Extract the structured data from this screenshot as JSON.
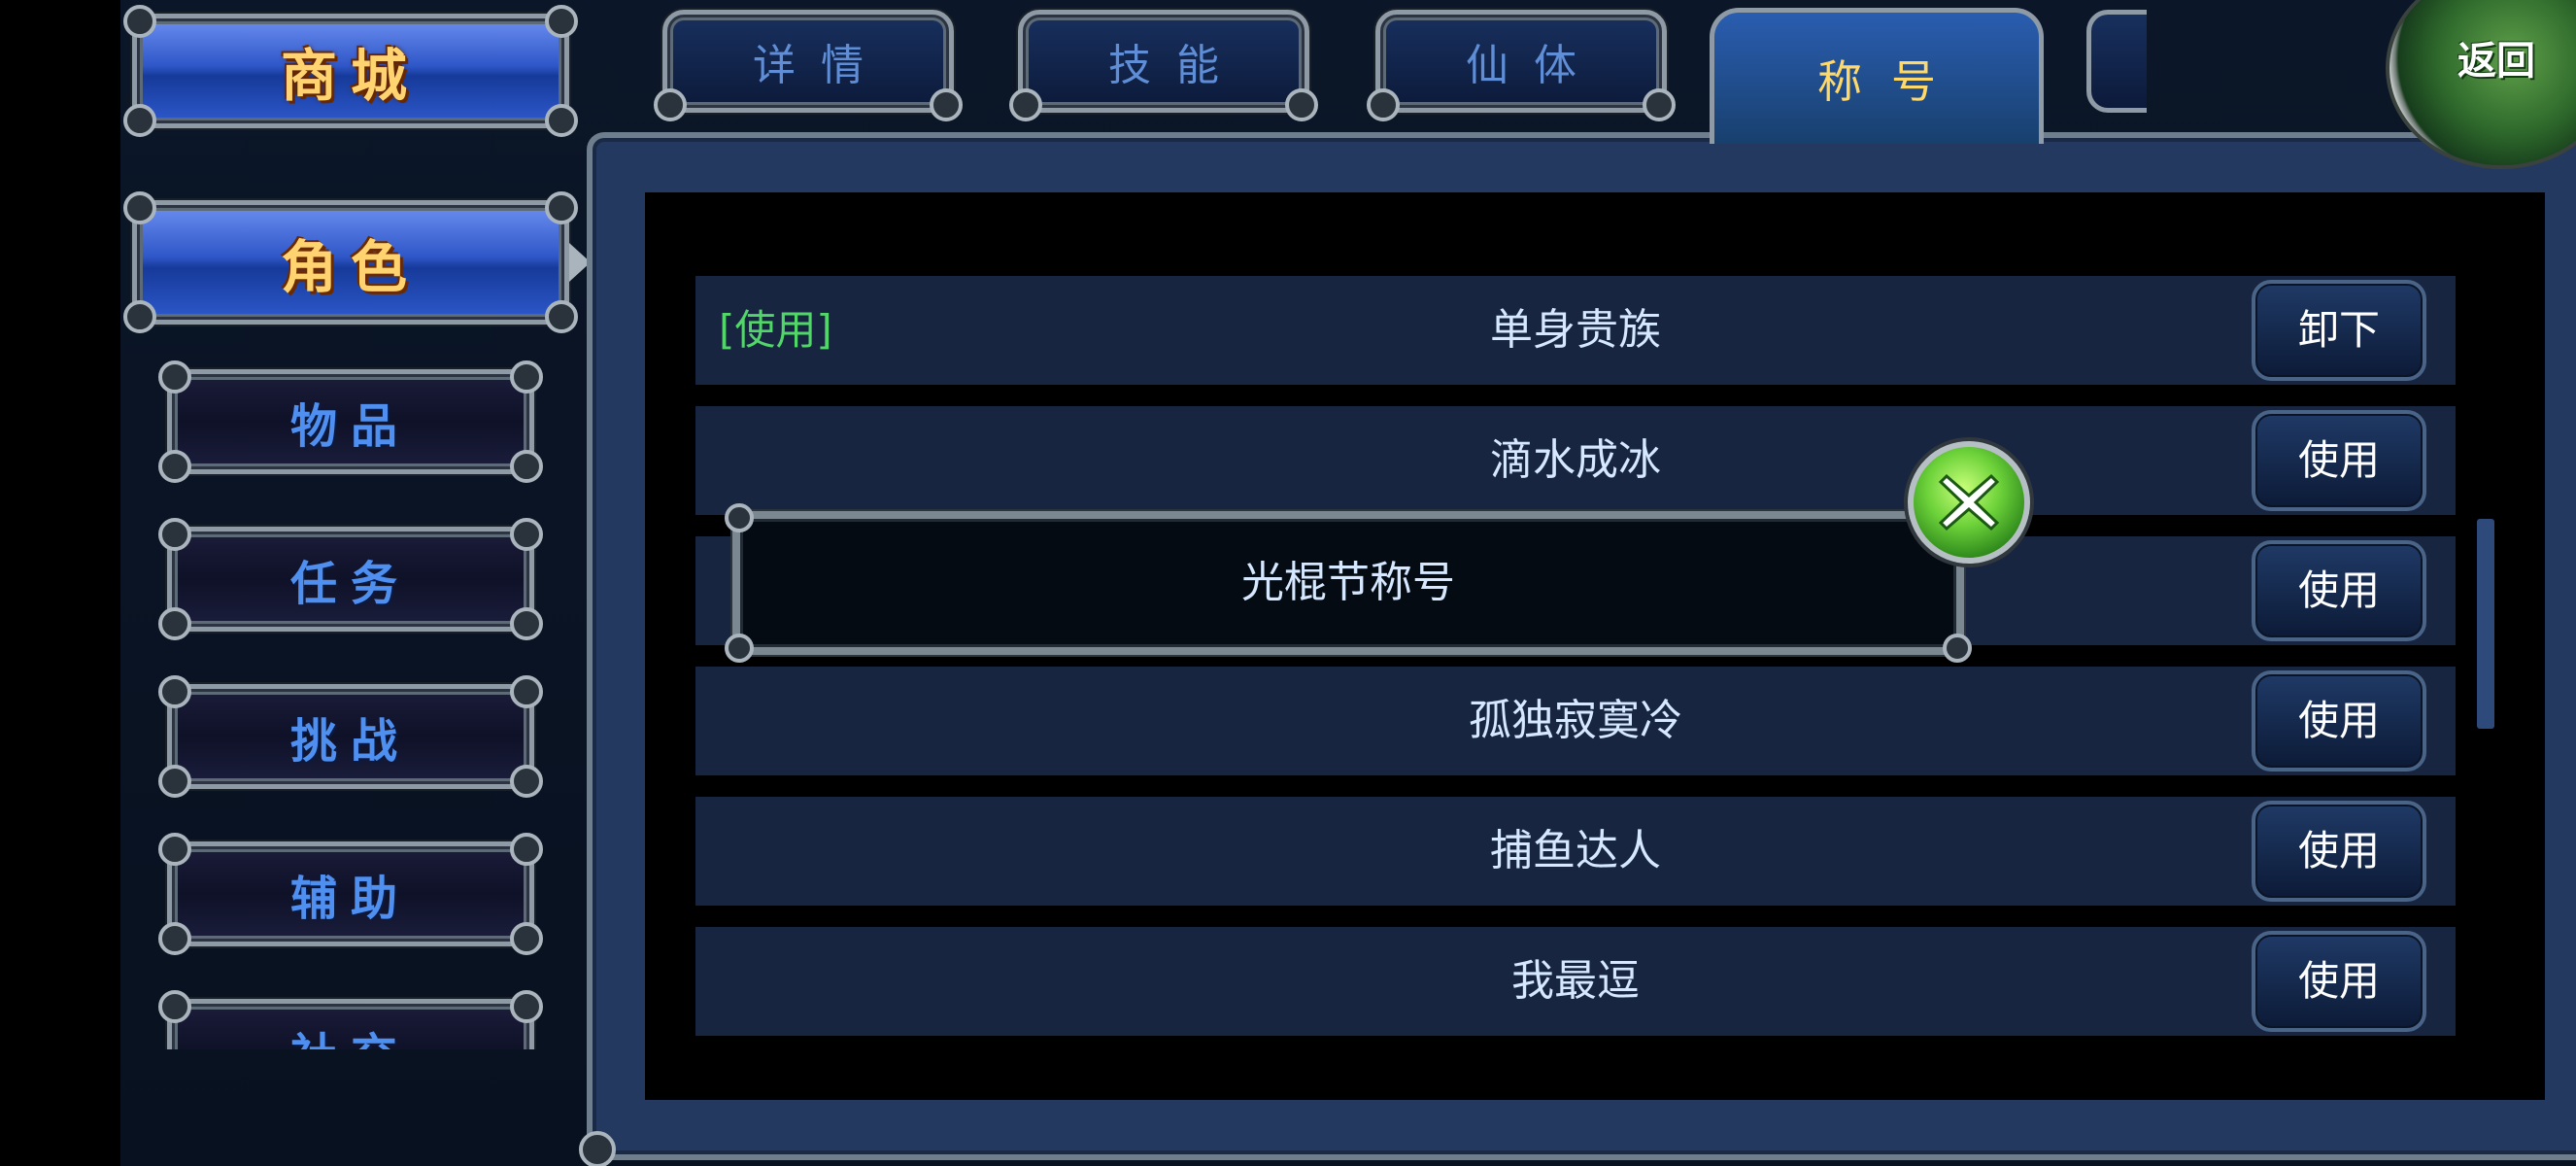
{
  "left_menu": {
    "shop": "商城",
    "role": "角色",
    "items": [
      {
        "label": "物品"
      },
      {
        "label": "任务"
      },
      {
        "label": "挑战"
      },
      {
        "label": "辅助"
      },
      {
        "label": "社交"
      }
    ]
  },
  "tabs": [
    {
      "label": "详情",
      "active": false
    },
    {
      "label": "技能",
      "active": false
    },
    {
      "label": "仙体",
      "active": false
    },
    {
      "label": "称号",
      "active": true
    }
  ],
  "back_button": "返回",
  "titles": [
    {
      "status": "[使用]",
      "name": "单身贵族",
      "action": "卸下"
    },
    {
      "status": "",
      "name": "滴水成冰",
      "action": "使用"
    },
    {
      "status": "",
      "name": "光棍节称号",
      "action": "使用"
    },
    {
      "status": "",
      "name": "孤独寂寞冷",
      "action": "使用"
    },
    {
      "status": "",
      "name": "捕鱼达人",
      "action": "使用"
    },
    {
      "status": "",
      "name": "我最逗",
      "action": "使用"
    }
  ],
  "popup": {
    "title": "光棍节称号",
    "close_icon": "close-x-icon"
  },
  "colors": {
    "in_use": "#52d66a",
    "active_tab_text": "#ffd86a",
    "menu_text": "#4f8ff0",
    "close_button": "#6dd23a"
  }
}
